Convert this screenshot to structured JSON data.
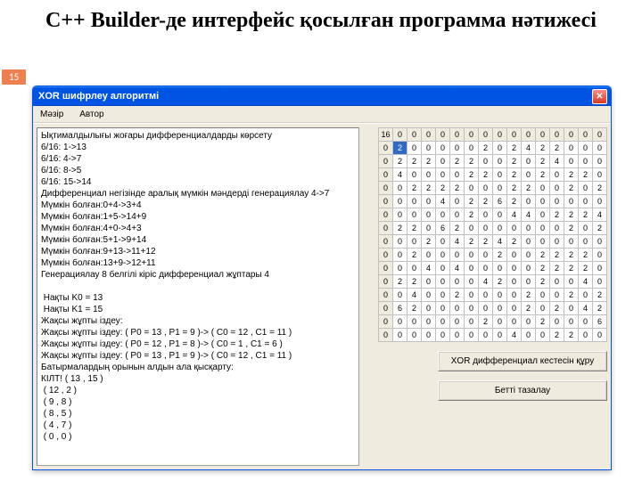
{
  "slide": {
    "title": "C++ Builder-де интерфейс қосылған программа нәтижесі",
    "page_number": "15"
  },
  "window": {
    "title": "XOR шифрлеу алгоритмі",
    "close_glyph": "✕",
    "menu": [
      "Мәзір",
      "Автор"
    ],
    "buttons": {
      "build_table": "XOR дифференциал кестесін құру",
      "clear_page": "Бетті тазалау"
    },
    "text_lines": [
      "Ықтималдылығы жоғары дифференциалдарды көрсету",
      "6/16: 1->13",
      "6/16: 4->7",
      "6/16: 8->5",
      "6/16: 15->14",
      "Дифференциал негізінде аралық мүмкін мәндерді генерациялау 4->7",
      "Мүмкін болған:0+4->3+4",
      "Мүмкін болған:1+5->14+9",
      "Мүмкін болған:4+0->4+3",
      "Мүмкін болған:5+1->9+14",
      "Мүмкін болған:9+13->11+12",
      "Мүмкін болған:13+9->12+11",
      "Генерациялау 8 белгілі кіріс дифференциал жұптары 4",
      "",
      " Нақты K0 = 13",
      " Нақты K1 = 15",
      "Жақсы жұпты іздеу:",
      "Жақсы жұпты іздеу: ( P0 = 13 , P1 = 9 )-> ( C0 = 12 , C1 = 11 )",
      "Жақсы жұпты іздеу: ( P0 = 12 , P1 = 8 )-> ( C0 = 1 , C1 = 6 )",
      "Жақсы жұпты іздеу: ( P0 = 13 , P1 = 9 )-> ( C0 = 12 , C1 = 11 )",
      "Батырмалардың орынын алдын ала қысқарту:",
      "КІЛТ! ( 13 , 15 )",
      " ( 12 , 2 )",
      " ( 9 , 8 )",
      " ( 8 , 5 )",
      " ( 4 , 7 )",
      " ( 0 , 0 )"
    ],
    "table": {
      "selected": [
        1,
        1
      ],
      "rows": [
        [
          16,
          0,
          0,
          0,
          0,
          0,
          0,
          0,
          0,
          0,
          0,
          0,
          0,
          0,
          0,
          0
        ],
        [
          0,
          2,
          0,
          0,
          0,
          0,
          0,
          2,
          0,
          2,
          4,
          2,
          2,
          0,
          0,
          0
        ],
        [
          0,
          2,
          2,
          2,
          0,
          2,
          2,
          0,
          0,
          2,
          0,
          2,
          4,
          0,
          0,
          0
        ],
        [
          0,
          4,
          0,
          0,
          0,
          0,
          2,
          2,
          0,
          2,
          0,
          2,
          0,
          2,
          2,
          0
        ],
        [
          0,
          0,
          2,
          2,
          2,
          2,
          0,
          0,
          0,
          2,
          2,
          0,
          0,
          2,
          0,
          2
        ],
        [
          0,
          0,
          0,
          0,
          4,
          0,
          2,
          2,
          6,
          2,
          0,
          0,
          0,
          0,
          0,
          0
        ],
        [
          0,
          0,
          0,
          0,
          0,
          0,
          2,
          0,
          0,
          4,
          4,
          0,
          2,
          2,
          2,
          4
        ],
        [
          0,
          2,
          2,
          0,
          6,
          2,
          0,
          0,
          0,
          0,
          0,
          0,
          0,
          2,
          0,
          2
        ],
        [
          0,
          0,
          0,
          2,
          0,
          4,
          2,
          2,
          4,
          2,
          0,
          0,
          0,
          0,
          0,
          0
        ],
        [
          0,
          0,
          2,
          0,
          0,
          0,
          0,
          0,
          2,
          0,
          0,
          2,
          2,
          2,
          2,
          0
        ],
        [
          0,
          0,
          0,
          4,
          0,
          4,
          0,
          0,
          0,
          0,
          0,
          2,
          2,
          2,
          2,
          0
        ],
        [
          0,
          2,
          2,
          0,
          0,
          0,
          0,
          4,
          2,
          0,
          0,
          2,
          0,
          0,
          4,
          0
        ],
        [
          0,
          0,
          4,
          0,
          0,
          2,
          0,
          0,
          0,
          0,
          2,
          0,
          0,
          2,
          0,
          2
        ],
        [
          0,
          6,
          2,
          0,
          0,
          0,
          0,
          0,
          0,
          0,
          2,
          0,
          2,
          0,
          4,
          2
        ],
        [
          0,
          0,
          0,
          0,
          0,
          0,
          0,
          2,
          0,
          0,
          0,
          2,
          0,
          0,
          0,
          6
        ],
        [
          0,
          0,
          0,
          0,
          0,
          0,
          0,
          0,
          0,
          4,
          0,
          0,
          2,
          2,
          0,
          0
        ]
      ]
    }
  }
}
